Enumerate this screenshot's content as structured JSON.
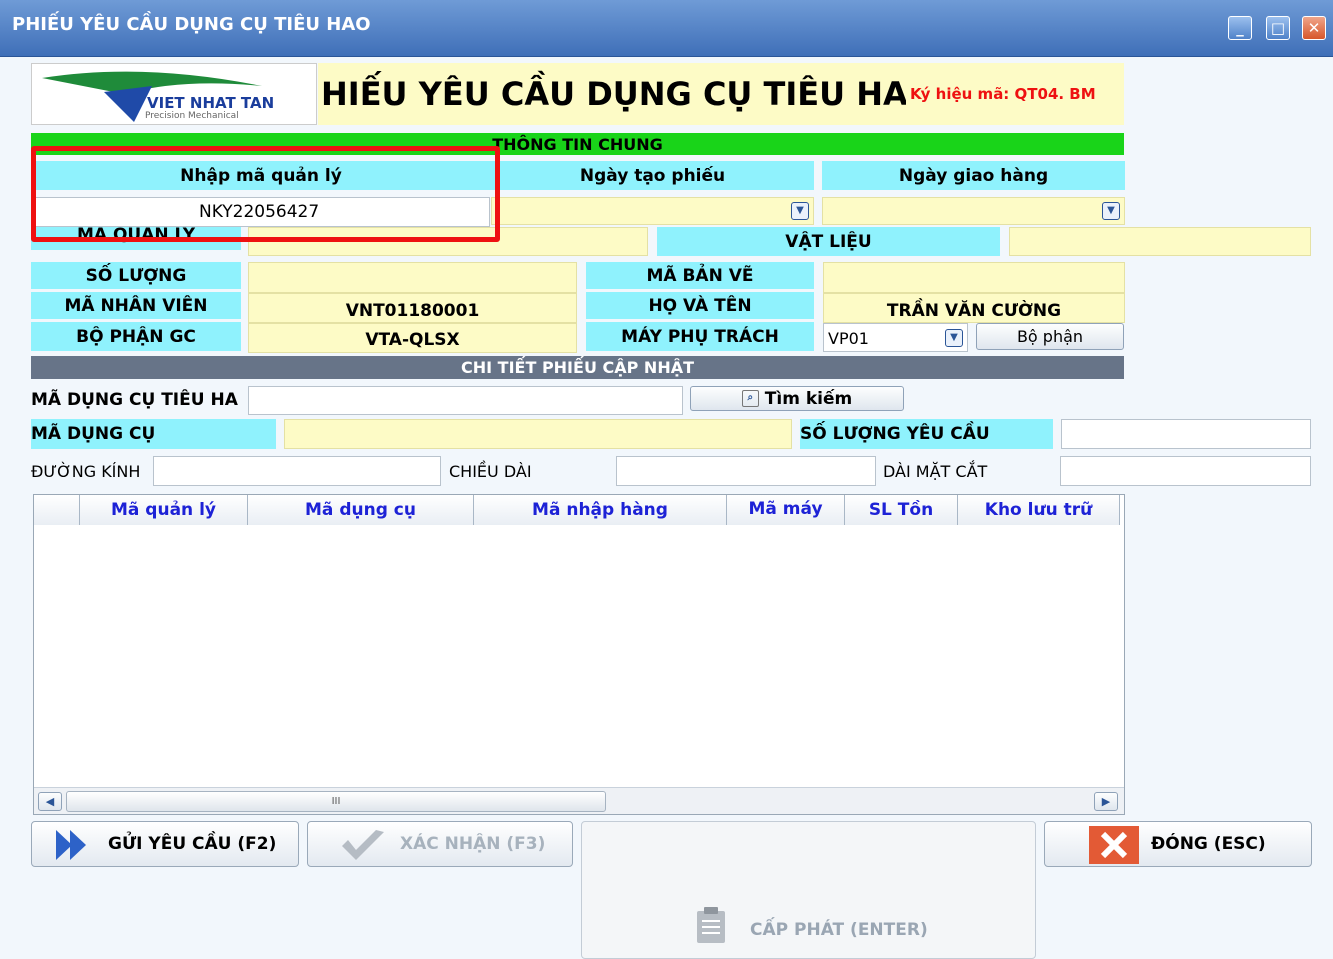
{
  "window": {
    "title": "PHIẾU YÊU CẦU DỤNG CỤ TIÊU HAO",
    "minimize": "_",
    "maximize": "□",
    "close": "✕"
  },
  "header": {
    "logo_text": "VIET NHAT TAN",
    "logo_subtext": "Precision Mechanical",
    "form_title": "HIẾU YÊU CẦU DỤNG CỤ TIÊU HA",
    "code_label": "Ký hiệu mã: QT04. BM"
  },
  "general": {
    "section_title": "THÔNG TIN CHUNG",
    "input_code_label": "Nhập mã quản lý",
    "input_code_value": "NKY22056427",
    "created_date_label": "Ngày tạo phiếu",
    "delivery_date_label": "Ngày giao hàng",
    "created_date_value": "",
    "delivery_date_value": "",
    "management_code_label": "MÃ QUẢN LÝ",
    "material_label": "VẬT LIỆU",
    "quantity_label": "SỐ LƯỢNG",
    "drawing_code_label": "MÃ BẢN VẼ",
    "employee_code_label": "MÃ NHÂN VIÊN",
    "employee_code_value": "VNT01180001",
    "full_name_label": "HỌ VÀ TÊN",
    "full_name_value": "TRẦN VĂN CƯỜNG",
    "department_label": "BỘ PHẬN GC",
    "department_value": "VTA-QLSX",
    "machine_label": "MÁY PHỤ TRÁCH",
    "machine_value": "VP01",
    "department_button": "Bộ phận"
  },
  "detail": {
    "section_title": "CHI TIẾT PHIẾU CẬP NHẬT",
    "consumable_code_label": "MÃ DỤNG CỤ TIÊU HA",
    "search_button": "Tìm kiếm",
    "tool_code_label": "MÃ DỤNG CỤ",
    "request_qty_label": "SỐ LƯỢNG YÊU CẦU",
    "diameter_label": "ĐƯỜNG KÍNH",
    "length_label": "CHIỀU DÀI",
    "cut_length_label": "DÀI MẶT CẮT"
  },
  "table": {
    "columns": [
      "Mã quản lý",
      "Mã dụng cụ",
      "Mã nhập hàng",
      "Mã máy",
      "SL Tồn",
      "Kho lưu trữ"
    ],
    "rows": [],
    "scroll_mark": "III"
  },
  "actions": {
    "send": "GỬI YÊU CẦU (F2)",
    "confirm": "XÁC NHẬN (F3)",
    "close": "ĐÓNG (ESC)",
    "issue": "CẤP PHÁT (ENTER)"
  },
  "colors": {
    "accent_blue": "#2b5597",
    "cyan": "#8ff2fd",
    "yellow": "#fdfbc6",
    "green": "#19d419",
    "highlight_red": "#ee1111"
  }
}
